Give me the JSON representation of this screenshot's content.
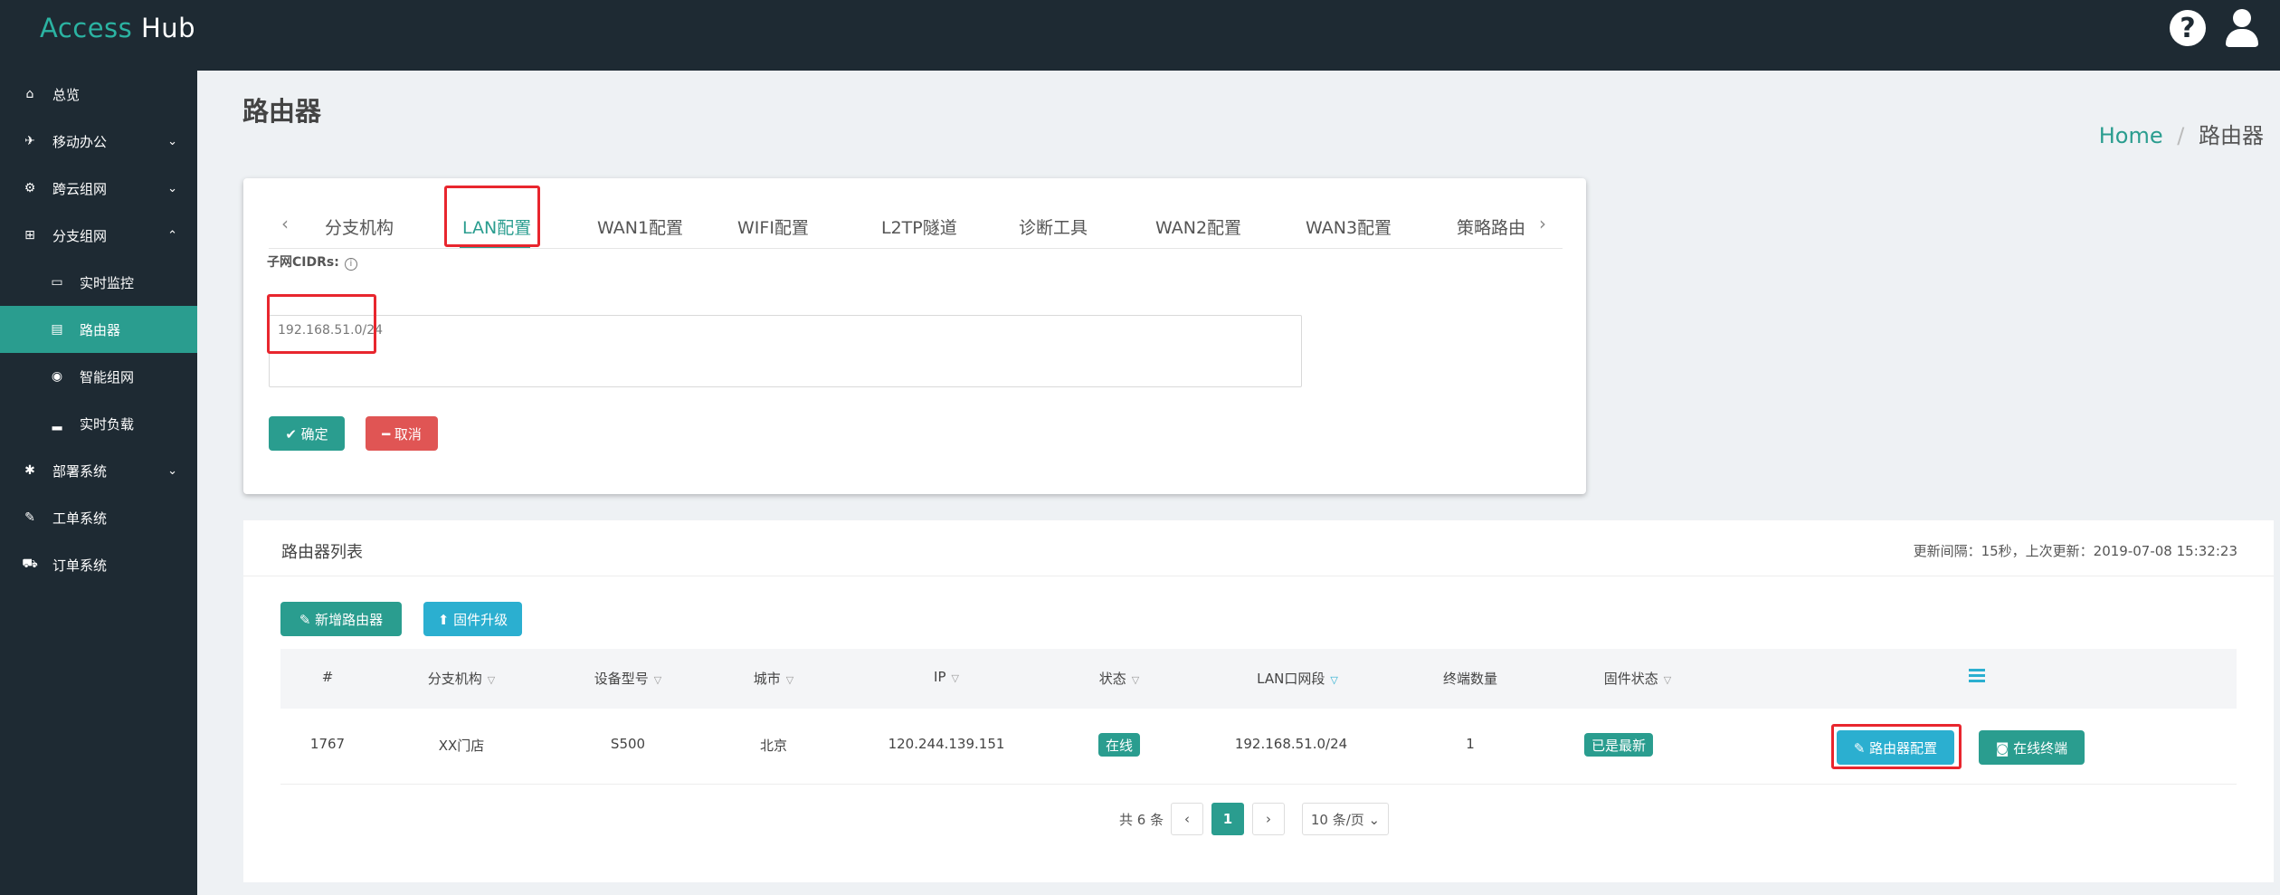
{
  "brand": {
    "part1": "Access",
    "part2": "Hub"
  },
  "header_icons": {
    "help": "?",
    "user": "user-icon"
  },
  "sidebar": {
    "items": [
      {
        "label": "总览",
        "icon": "⌂"
      },
      {
        "label": "移动办公",
        "icon": "✈",
        "chevron": "⌄"
      },
      {
        "label": "跨云组网",
        "icon": "⚙",
        "chevron": "⌄"
      },
      {
        "label": "分支组网",
        "icon": "⊞",
        "chevron": "⌃"
      },
      {
        "label": "实时监控",
        "icon": "▭"
      },
      {
        "label": "路由器",
        "icon": "▤"
      },
      {
        "label": "智能组网",
        "icon": "◉"
      },
      {
        "label": "实时负载",
        "icon": "▂"
      },
      {
        "label": "部署系统",
        "icon": "✱",
        "chevron": "⌄"
      },
      {
        "label": "工单系统",
        "icon": "✎"
      },
      {
        "label": "订单系统",
        "icon": "⛟"
      }
    ]
  },
  "page": {
    "title": "路由器"
  },
  "breadcrumb": {
    "home": "Home",
    "sep": "/",
    "current": "路由器"
  },
  "config": {
    "tabs": [
      "分支机构",
      "LAN配置",
      "WAN1配置",
      "WIFI配置",
      "L2TP隧道",
      "诊断工具",
      "WAN2配置",
      "WAN3配置",
      "策略路由"
    ],
    "arrow_left": "‹",
    "arrow_right": "›",
    "field_label": "子网CIDRs:",
    "info": "i",
    "cidr_value": "192.168.51.0/24",
    "ok_label": "✔ 确定",
    "cancel_label": "━ 取消"
  },
  "router_list": {
    "title": "路由器列表",
    "update_info": "更新间隔：15秒，上次更新：2019-07-08 15:32:23",
    "add_label": "✎ 新增路由器",
    "upgrade_label": "⬆ 固件升级",
    "columns": [
      "#",
      "分支机构",
      "设备型号",
      "城市",
      "IP",
      "状态",
      "LAN口网段",
      "终端数量",
      "固件状态"
    ],
    "filter_glyph": "▽",
    "rows": [
      {
        "id": "1767",
        "branch": "XX门店",
        "model": "S500",
        "city": "北京",
        "ip": "120.244.139.151",
        "status": "在线",
        "lan": "192.168.51.0/24",
        "terminals": "1",
        "firmware": "已是最新",
        "config_label": "✎ 路由器配置",
        "terminal_label": "◙ 在线终端"
      }
    ],
    "pager": {
      "total": "共 6 条",
      "prev": "‹",
      "page": "1",
      "next": "›",
      "page_size": "10 条/页 ⌄"
    }
  },
  "colors": {
    "accent": "#2a9d8f",
    "info": "#2bafd0",
    "danger": "#e05554",
    "highlight": "#e8262e",
    "sidebar": "#1e2a33"
  }
}
